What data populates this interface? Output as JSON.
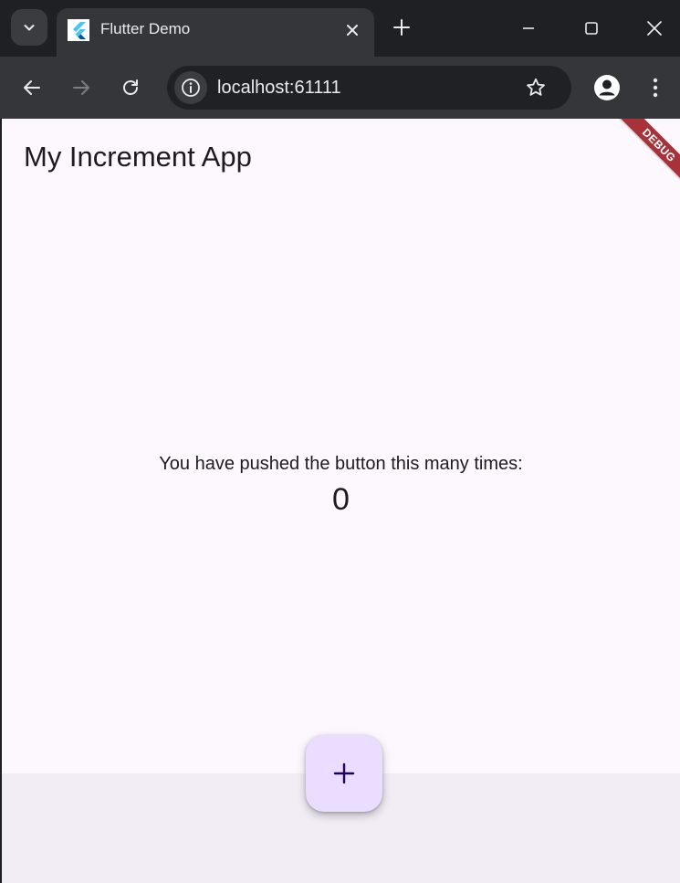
{
  "browser": {
    "tab": {
      "title": "Flutter Demo",
      "favicon": "flutter-logo"
    },
    "address": {
      "url": "localhost:61111"
    },
    "icons": {
      "tab_search": "chevron-down-icon",
      "tab_close": "close-icon",
      "new_tab": "plus-icon",
      "minimize": "minimize-icon",
      "maximize": "maximize-icon",
      "close_window": "close-icon",
      "back": "back-arrow-icon",
      "forward": "forward-arrow-icon",
      "reload": "reload-icon",
      "site_info": "info-icon",
      "bookmark": "star-icon",
      "profile": "profile-icon",
      "menu": "kebab-menu-icon"
    },
    "colors": {
      "frame": "#1f2023",
      "toolbar": "#35363a",
      "omnibox": "#202124",
      "text": "#e8eaed"
    }
  },
  "app": {
    "title": "My Increment App",
    "counter_label": "You have pushed the button this many times:",
    "counter_value": "0",
    "fab_icon": "plus-icon",
    "debug_banner": "DEBUG",
    "colors": {
      "background": "#fdf7fe",
      "bottom_bar": "#f2ecf5",
      "fab": "#eaddff",
      "banner": "#a7323a"
    }
  }
}
